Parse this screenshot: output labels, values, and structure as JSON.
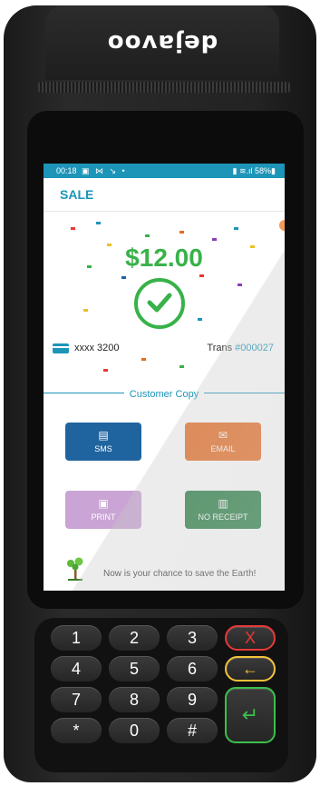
{
  "device": {
    "brand_logo": "dejavoo"
  },
  "status_bar": {
    "time": "00:18",
    "left_icons": "▣ ⋈ ↘ •",
    "right_text": "▮ ≋.ıl 58%▮"
  },
  "header": {
    "title": "SALE"
  },
  "transaction": {
    "amount": "$12.00",
    "card_masked": "xxxx 3200",
    "trans_label": "Trans",
    "trans_number": "#000027"
  },
  "receipt": {
    "section_label": "Customer Copy",
    "buttons": [
      {
        "label": "SMS",
        "icon": "chat-icon"
      },
      {
        "label": "EMAIL",
        "icon": "envelope-icon"
      },
      {
        "label": "PRINT",
        "icon": "printer-icon"
      },
      {
        "label": "NO RECEIPT",
        "icon": "receipt-icon"
      }
    ],
    "eco_message": "Now is your chance to save the Earth!"
  },
  "keypad": {
    "keys": [
      "1",
      "2",
      "3",
      "4",
      "5",
      "6",
      "7",
      "8",
      "9",
      "*",
      "0",
      "#"
    ],
    "cancel": "X",
    "backspace": "←",
    "enter": "↵"
  },
  "colors": {
    "accent": "#1c95b8",
    "success": "#38b249",
    "sms": "#20649f",
    "email": "#e86a1f",
    "print": "#c9a4d4",
    "no_receipt": "#1e7a3c"
  }
}
